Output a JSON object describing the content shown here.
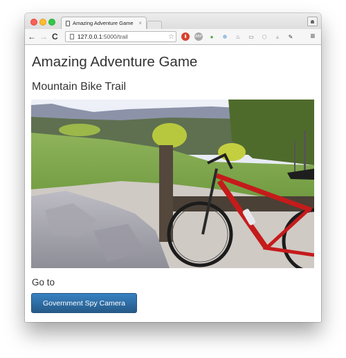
{
  "browser": {
    "tab_title": "Amazing Adventure Game",
    "tab_close_glyph": "×",
    "url_host": "127.0.0.1",
    "url_rest": ":5000/trail",
    "nav": {
      "back_glyph": "←",
      "forward_glyph": "→",
      "reload_glyph": "C"
    },
    "bookmark_glyph": "☆",
    "extensions": [
      {
        "name": "download-extension-icon",
        "glyph": "⬇",
        "color": "#d9412f"
      },
      {
        "name": "adblock-plus-icon",
        "glyph": "ABP",
        "color": "#9a9a9a"
      },
      {
        "name": "evernote-speech-icon",
        "glyph": "●",
        "color": "#4aa53d"
      },
      {
        "name": "bug-extension-icon",
        "glyph": "✲",
        "color": "#3a86c8"
      },
      {
        "name": "sneaker-extension-icon",
        "glyph": "♨",
        "color": "#777777"
      },
      {
        "name": "cast-icon",
        "glyph": "▭",
        "color": "#666666"
      },
      {
        "name": "cube-extension-icon",
        "glyph": "⬡",
        "color": "#a0a0a0"
      },
      {
        "name": "drive-extension-icon",
        "glyph": "▲",
        "color": "#c4c4c4"
      },
      {
        "name": "eyedropper-icon",
        "glyph": "✎",
        "color": "#333333"
      }
    ],
    "menu_glyph": "≡"
  },
  "page": {
    "title": "Amazing Adventure Game",
    "location": "Mountain Bike Trail",
    "photo_alt": "Red mountain bike leaning against a wooden fence on a rocky trail overlooking green hills",
    "goto_heading": "Go to",
    "destinations": [
      {
        "label": "Government Spy Camera"
      }
    ]
  },
  "colors": {
    "button_top": "#3781c2",
    "button_bottom": "#265a88",
    "text": "#333333"
  }
}
